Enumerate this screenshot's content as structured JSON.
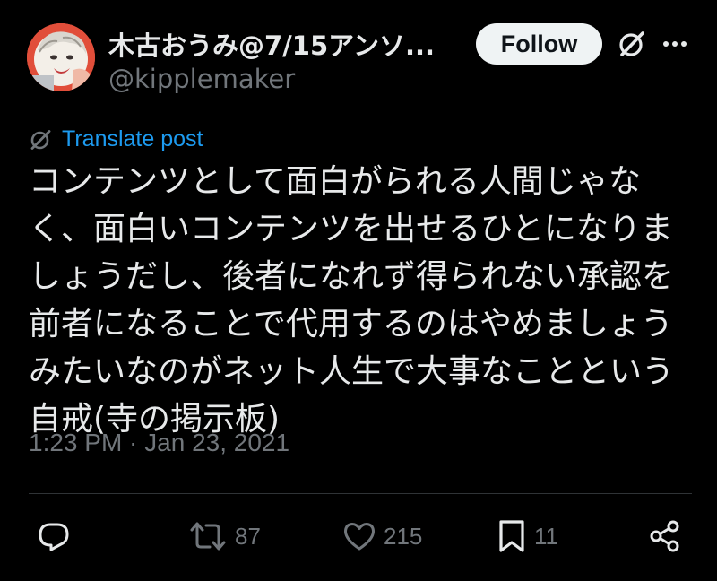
{
  "author": {
    "display_name": "木古おうみ@7/15アンソ...",
    "handle": "@kipplemaker",
    "avatar_icon": "avatar-illustration"
  },
  "header": {
    "follow_label": "Follow",
    "grok_icon": "grok-icon",
    "more_icon": "more-dots-icon"
  },
  "translate": {
    "label": "Translate post",
    "icon": "grok-icon"
  },
  "tweet": {
    "lines": [
      "コンテンツとして面白がられる人間じゃな",
      "く、面白いコンテンツを出せるひとになりま",
      "しょうだし、後者になれず得られない承認を",
      "前者になることで代用するのはやめましょう",
      "みたいなのがネット人生で大事なことという",
      "自戒(寺の掲示板)"
    ],
    "timestamp": "1:23 PM · Jan 23, 2021"
  },
  "actions": {
    "reply": {
      "icon": "reply-icon",
      "count": ""
    },
    "retweet": {
      "icon": "retweet-icon",
      "count": "87"
    },
    "like": {
      "icon": "heart-icon",
      "count": "215"
    },
    "bookmark": {
      "icon": "bookmark-icon",
      "count": "11"
    },
    "share": {
      "icon": "share-icon"
    }
  },
  "colors": {
    "background": "#000000",
    "text": "#e7e9ea",
    "secondary": "#71767b",
    "link": "#1d9bf0",
    "follow_bg": "#eff3f4"
  }
}
